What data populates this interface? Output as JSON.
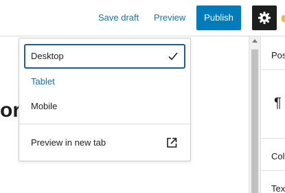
{
  "toolbar": {
    "save_draft": "Save draft",
    "preview": "Preview",
    "publish": "Publish",
    "settings_icon": "gear-icon"
  },
  "editor": {
    "text_fragment": "or"
  },
  "sidebar": {
    "items": [
      {
        "label": "Pos"
      },
      {
        "label": "¶"
      },
      {
        "label": "Colo"
      },
      {
        "label": "Tex"
      }
    ]
  },
  "preview_menu": {
    "options": [
      {
        "label": "Desktop",
        "selected": true
      },
      {
        "label": "Tablet",
        "selected": false
      },
      {
        "label": "Mobile",
        "selected": false
      }
    ],
    "open_new_tab": "Preview in new tab"
  },
  "colors": {
    "accent": "#007cba",
    "link": "#1a73a8",
    "focus_border": "#1a5e9a"
  }
}
